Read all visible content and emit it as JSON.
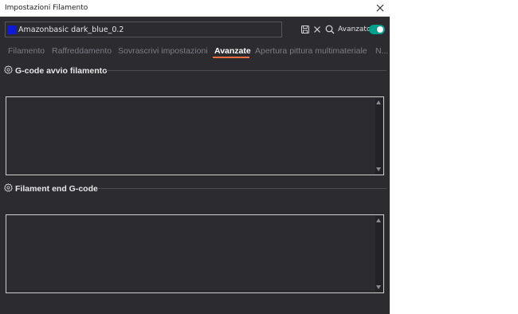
{
  "window": {
    "title": "Impostazioni Filamento"
  },
  "preset": {
    "name": "Amazonbasic dark_blue_0.2",
    "color": "#0e1ad8"
  },
  "toolbar": {
    "save_icon": "save-icon",
    "delete_icon": "close-icon",
    "search_icon": "search-icon",
    "advanced_label": "Avanzato",
    "advanced_on": true,
    "toggle_color": "#00a28e"
  },
  "tabs": [
    {
      "label": "Filamento",
      "active": false
    },
    {
      "label": "Raffreddamento",
      "active": false
    },
    {
      "label": "Sovrascrivi impostazioni",
      "active": false
    },
    {
      "label": "Avanzate",
      "active": true
    },
    {
      "label": "Apertura pittura multimateriale",
      "active": false
    },
    {
      "label": "N...",
      "active": false
    }
  ],
  "accent_color": "#ef6c3c",
  "sections": [
    {
      "title": "G-code avvio filamento",
      "value": ""
    },
    {
      "title": "Filament end G-code",
      "value": ""
    }
  ]
}
